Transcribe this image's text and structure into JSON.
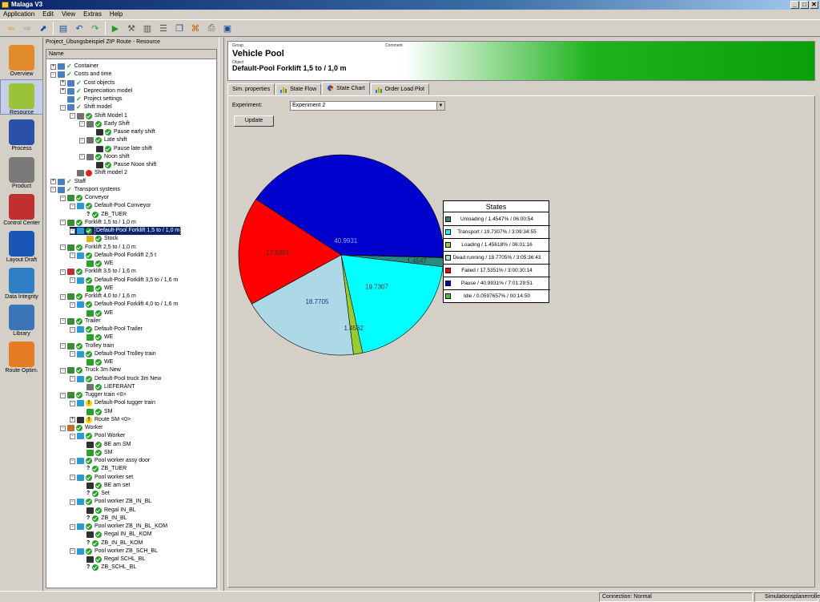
{
  "window": {
    "title": "Malaga V3",
    "controls": [
      "_",
      "□",
      "✕"
    ]
  },
  "menu": [
    "Application",
    "Edit",
    "View",
    "Extras",
    "Help"
  ],
  "toolbar_icons": [
    "back-icon",
    "forward-icon",
    "export-icon",
    "open-icon",
    "undo-icon",
    "redo-icon",
    "run-icon",
    "tool-icon",
    "bin-icon",
    "list-icon",
    "copy-icon",
    "xml-icon",
    "print-icon",
    "window-icon"
  ],
  "sidebar": [
    {
      "label": "Overview",
      "icon": "overview-icon",
      "color": "#e08a2a"
    },
    {
      "label": "Resource",
      "icon": "resource-icon",
      "color": "#9ac33a",
      "active": true
    },
    {
      "label": "Process",
      "icon": "process-icon",
      "color": "#2a4fa8"
    },
    {
      "label": "Product",
      "icon": "product-icon",
      "color": "#7a7a7a"
    },
    {
      "label": "Control Center",
      "icon": "control-center-icon",
      "color": "#c03030"
    },
    {
      "label": "Layout Draft",
      "icon": "layout-draft-icon",
      "color": "#1a57b5"
    },
    {
      "label": "Data Integrity",
      "icon": "data-integrity-icon",
      "color": "#2f7fc5"
    },
    {
      "label": "Library",
      "icon": "library-icon",
      "color": "#3c74b8"
    },
    {
      "label": "Route Optim.",
      "icon": "route-optim-icon",
      "color": "#e47c24"
    }
  ],
  "tree": {
    "title": "Project_Übungsbeispiel ZIP Route - Resource",
    "column": "Name",
    "rows": [
      {
        "label": "Container",
        "indent": 0,
        "exp": "+",
        "status": "check",
        "icon": "#4a7fc0"
      },
      {
        "label": "Costs and time",
        "indent": 0,
        "exp": "-",
        "status": "check",
        "icon": "#4a7fc0"
      },
      {
        "label": "Cost objects",
        "indent": 1,
        "exp": "+",
        "status": "check",
        "icon": "#4a7fc0"
      },
      {
        "label": "Depreciation model",
        "indent": 1,
        "exp": "+",
        "status": "check",
        "icon": "#4a7fc0"
      },
      {
        "label": "Project settings",
        "indent": 1,
        "exp": "",
        "status": "check",
        "icon": "#4a7fc0"
      },
      {
        "label": "Shift model",
        "indent": 1,
        "exp": "-",
        "status": "check",
        "icon": "#4a7fc0"
      },
      {
        "label": "Shift Model 1",
        "indent": 2,
        "exp": "-",
        "status": "ok",
        "icon": "#707070"
      },
      {
        "label": "Early Shift",
        "indent": 3,
        "exp": "-",
        "status": "ok",
        "icon": "#707070"
      },
      {
        "label": "Pause early shift",
        "indent": 4,
        "exp": "",
        "status": "ok",
        "icon": "#303030"
      },
      {
        "label": "Late shift",
        "indent": 3,
        "exp": "-",
        "status": "ok",
        "icon": "#707070"
      },
      {
        "label": "Pause late shift",
        "indent": 4,
        "exp": "",
        "status": "ok",
        "icon": "#303030"
      },
      {
        "label": "Noon shift",
        "indent": 3,
        "exp": "-",
        "status": "ok",
        "icon": "#707070"
      },
      {
        "label": "Pause Noon shift",
        "indent": 4,
        "exp": "",
        "status": "ok",
        "icon": "#303030"
      },
      {
        "label": "Shift model 2",
        "indent": 2,
        "exp": "",
        "status": "err",
        "icon": "#707070"
      },
      {
        "label": "Staff",
        "indent": 0,
        "exp": "+",
        "status": "check",
        "icon": "#4a7fc0"
      },
      {
        "label": "Transport systems",
        "indent": 0,
        "exp": "-",
        "status": "check",
        "icon": "#4a7fc0"
      },
      {
        "label": "Conveyor",
        "indent": 1,
        "exp": "-",
        "status": "ok",
        "icon": "#3a8a3a"
      },
      {
        "label": "Default-Pool Conveyor",
        "indent": 2,
        "exp": "-",
        "status": "ok",
        "icon": "#2a9ad0"
      },
      {
        "label": "ZB_TUER",
        "indent": 3,
        "exp": "",
        "status": "ok",
        "icon": "q"
      },
      {
        "label": "Forklift 1,5 to / 1,0 m",
        "indent": 1,
        "exp": "-",
        "status": "ok",
        "icon": "#3a8a3a"
      },
      {
        "label": "Default-Pool Forklift 1,5 to / 1,0 m",
        "indent": 2,
        "exp": "-",
        "status": "ok",
        "icon": "#2a9ad0",
        "selected": true
      },
      {
        "label": "Stock",
        "indent": 3,
        "exp": "",
        "status": "ok",
        "icon": "#e0b020"
      },
      {
        "label": "Forklift 2,5 to / 1,0 m",
        "indent": 1,
        "exp": "-",
        "status": "ok",
        "icon": "#3a8a3a"
      },
      {
        "label": "Default-Pool Forklift 2,5 t",
        "indent": 2,
        "exp": "-",
        "status": "ok",
        "icon": "#2a9ad0"
      },
      {
        "label": "WE",
        "indent": 3,
        "exp": "",
        "status": "ok",
        "icon": "#2aa02a"
      },
      {
        "label": "Forklift 3,5 to / 1,6 m",
        "indent": 1,
        "exp": "-",
        "status": "ok",
        "icon": "#c03030"
      },
      {
        "label": "Default-Pool Forklift 3,5 to / 1,6 m",
        "indent": 2,
        "exp": "-",
        "status": "ok",
        "icon": "#2a9ad0"
      },
      {
        "label": "WE",
        "indent": 3,
        "exp": "",
        "status": "ok",
        "icon": "#2aa02a"
      },
      {
        "label": "Forklift 4,0 to / 1,6 m",
        "indent": 1,
        "exp": "-",
        "status": "ok",
        "icon": "#3a8a3a"
      },
      {
        "label": "Default-Pool Forklift 4,0 to / 1,6 m",
        "indent": 2,
        "exp": "-",
        "status": "ok",
        "icon": "#2a9ad0"
      },
      {
        "label": "WE",
        "indent": 3,
        "exp": "",
        "status": "ok",
        "icon": "#2aa02a"
      },
      {
        "label": "Trailer",
        "indent": 1,
        "exp": "-",
        "status": "ok",
        "icon": "#3a8a3a"
      },
      {
        "label": "Default-Pool Trailer",
        "indent": 2,
        "exp": "-",
        "status": "ok",
        "icon": "#2a9ad0"
      },
      {
        "label": "WE",
        "indent": 3,
        "exp": "",
        "status": "ok",
        "icon": "#2aa02a"
      },
      {
        "label": "Trolley train",
        "indent": 1,
        "exp": "-",
        "status": "ok",
        "icon": "#3a8a3a"
      },
      {
        "label": "Default-Pool Trolley train",
        "indent": 2,
        "exp": "-",
        "status": "ok",
        "icon": "#2a9ad0"
      },
      {
        "label": "WE",
        "indent": 3,
        "exp": "",
        "status": "ok",
        "icon": "#2aa02a"
      },
      {
        "label": "Truck 3m New",
        "indent": 1,
        "exp": "-",
        "status": "ok",
        "icon": "#3a8a3a"
      },
      {
        "label": "Default-Pool truck 3m New",
        "indent": 2,
        "exp": "-",
        "status": "ok",
        "icon": "#2a9ad0"
      },
      {
        "label": "LIEFERANT",
        "indent": 3,
        "exp": "",
        "status": "ok",
        "icon": "#707070"
      },
      {
        "label": "Tugger train <0>",
        "indent": 1,
        "exp": "-",
        "status": "ok",
        "icon": "#3a8a3a"
      },
      {
        "label": "Default-Pool tugger train",
        "indent": 2,
        "exp": "-",
        "status": "warn",
        "icon": "#2a9ad0"
      },
      {
        "label": "SM",
        "indent": 3,
        "exp": "",
        "status": "ok",
        "icon": "#2aa02a"
      },
      {
        "label": "Route SM <0>",
        "indent": 2,
        "exp": "+",
        "status": "warn",
        "icon": "#303030"
      },
      {
        "label": "Worker",
        "indent": 1,
        "exp": "-",
        "status": "ok",
        "icon": "#c07030"
      },
      {
        "label": "Pool Worker",
        "indent": 2,
        "exp": "-",
        "status": "ok",
        "icon": "#2a9ad0"
      },
      {
        "label": "BE am SM",
        "indent": 3,
        "exp": "",
        "status": "ok",
        "icon": "#303030"
      },
      {
        "label": "SM",
        "indent": 3,
        "exp": "",
        "status": "ok",
        "icon": "#2aa02a"
      },
      {
        "label": "Pool worker assy door",
        "indent": 2,
        "exp": "-",
        "status": "ok",
        "icon": "#2a9ad0"
      },
      {
        "label": "ZB_TUER",
        "indent": 3,
        "exp": "",
        "status": "ok",
        "icon": "q"
      },
      {
        "label": "Pool worker set",
        "indent": 2,
        "exp": "-",
        "status": "ok",
        "icon": "#2a9ad0"
      },
      {
        "label": "BE am set",
        "indent": 3,
        "exp": "",
        "status": "ok",
        "icon": "#303030"
      },
      {
        "label": "Set",
        "indent": 3,
        "exp": "",
        "status": "ok",
        "icon": "q"
      },
      {
        "label": "Pool worker ZB_IN_BL",
        "indent": 2,
        "exp": "-",
        "status": "ok",
        "icon": "#2a9ad0"
      },
      {
        "label": "Regal IN_BL",
        "indent": 3,
        "exp": "",
        "status": "ok",
        "icon": "#303030"
      },
      {
        "label": "ZB_IN_BL",
        "indent": 3,
        "exp": "",
        "status": "ok",
        "icon": "q"
      },
      {
        "label": "Pool worker ZB_IN_BL_KOM",
        "indent": 2,
        "exp": "-",
        "status": "ok",
        "icon": "#2a9ad0"
      },
      {
        "label": "Regal IN_BL_KOM",
        "indent": 3,
        "exp": "",
        "status": "ok",
        "icon": "#303030"
      },
      {
        "label": "ZB_IN_BL_KOM",
        "indent": 3,
        "exp": "",
        "status": "ok",
        "icon": "q"
      },
      {
        "label": "Pool worker ZB_SCH_BL",
        "indent": 2,
        "exp": "-",
        "status": "ok",
        "icon": "#2a9ad0"
      },
      {
        "label": "Regal SCHL_BL",
        "indent": 3,
        "exp": "",
        "status": "ok",
        "icon": "#303030"
      },
      {
        "label": "ZB_SCHL_BL",
        "indent": 3,
        "exp": "",
        "status": "ok",
        "icon": "q"
      }
    ]
  },
  "header": {
    "group_label": "Group",
    "title": "Vehicle Pool",
    "comment_label": "Comment",
    "object_label": "Object",
    "subtitle": "Default-Pool Forklift 1,5 to / 1,0 m"
  },
  "tabs": [
    {
      "label": "Sim. properties",
      "icon": ""
    },
    {
      "label": "State Flow",
      "icon": "bar-chart-icon"
    },
    {
      "label": "State Chart",
      "icon": "pie-chart-icon",
      "active": true
    },
    {
      "label": "Order Load Plot",
      "icon": "bar-chart-icon"
    }
  ],
  "experiment": {
    "label": "Experiment:",
    "value": "Experiment 2"
  },
  "update_label": "Update",
  "chart_data": {
    "type": "pie",
    "title": "",
    "legend_title": "States",
    "legend_position": "right",
    "slices": [
      {
        "name": "Unloading",
        "value": 1.4547,
        "legend": "Unloading / 1.4547% / 06:00:54",
        "data_label": "1.4547",
        "color": "#2a8a80"
      },
      {
        "name": "Transport",
        "value": 19.7307,
        "legend": "Transport / 19.7307% / 3:09:34:55",
        "data_label": "19.7307",
        "color": "#00ffff"
      },
      {
        "name": "Loading",
        "value": 1.45618,
        "legend": "Loading / 1.45618% / 06:01:16",
        "data_label": "1.4562",
        "color": "#99cc33"
      },
      {
        "name": "Dead running",
        "value": 18.7705,
        "legend": "Dead running / 18.7705% / 3:05:36:43",
        "data_label": "18.7705",
        "color": "#add8e6"
      },
      {
        "name": "Failed",
        "value": 17.5351,
        "legend": "Failed / 17.5351% / 3:00:30:14",
        "data_label": "17.5351",
        "color": "#ff0000"
      },
      {
        "name": "Pause",
        "value": 40.9931,
        "legend": "Pause / 40.9931% / 7:01:29:51",
        "data_label": "40.9931",
        "color": "#0000cc"
      },
      {
        "name": "Idle",
        "value": 0.0597657,
        "legend": "Idle / 0.0597657% / 00:14:50",
        "data_label": "",
        "color": "#33cc33"
      }
    ]
  },
  "status": {
    "connection": "Connection: Normal",
    "user": "Simulationsplanerrolle"
  }
}
